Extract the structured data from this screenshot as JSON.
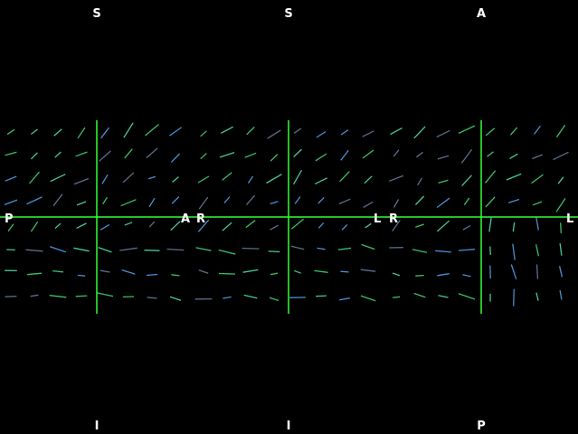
{
  "viewer": {
    "background": "#000000",
    "crosshair_color": "#33ff33",
    "label_color": "#ffffff",
    "vector_colors": [
      "#3bbf6a",
      "#4a8fd0",
      "#5a6f8a",
      "#46c8a0"
    ],
    "panels": [
      {
        "name": "sagittal",
        "top": "S",
        "bottom": "I",
        "left": "P",
        "right": "A"
      },
      {
        "name": "coronal",
        "top": "S",
        "bottom": "I",
        "left": "R",
        "right": "L"
      },
      {
        "name": "axial",
        "top": "A",
        "bottom": "P",
        "left": "R",
        "right": "L"
      }
    ]
  }
}
